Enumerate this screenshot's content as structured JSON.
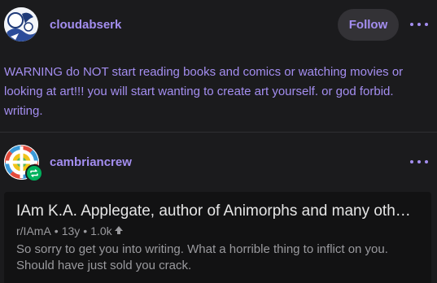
{
  "post": {
    "author": "cloudabserk",
    "follow_label": "Follow",
    "body": "WARNING do NOT start reading books and comics or watching movies or looking at art!!! you will start wanting to create art yourself. or god forbid. writing."
  },
  "reblog": {
    "author": "cambriancrew"
  },
  "link_card": {
    "title": "IAm K.A. Applegate, author of Animorphs and many oth…",
    "subreddit": "r/IAmA",
    "age": "13y",
    "score": "1.0k",
    "separator": "•",
    "excerpt": "So sorry to get you into writing.  What a horrible thing to inflict on you.  Should have just sold you crack."
  },
  "colors": {
    "accent": "#a48ef0",
    "background": "#1b1b1d",
    "card_background": "#121213",
    "reblog_green": "#00b15d"
  },
  "icons": {
    "more": "ellipsis-icon",
    "reblog": "reblog-icon",
    "upvote": "upvote-arrow-icon"
  }
}
